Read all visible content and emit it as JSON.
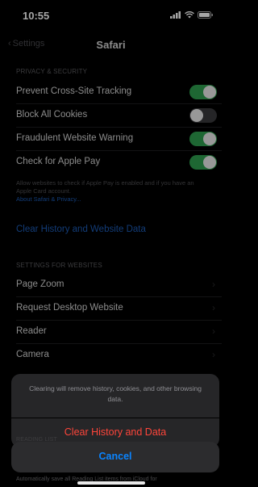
{
  "status_bar": {
    "time": "10:55"
  },
  "nav": {
    "back_label": "Settings",
    "title": "Safari"
  },
  "privacy_section": {
    "header": "PRIVACY & SECURITY",
    "rows": [
      {
        "label": "Prevent Cross-Site Tracking",
        "enabled": true
      },
      {
        "label": "Block All Cookies",
        "enabled": false
      },
      {
        "label": "Fraudulent Website Warning",
        "enabled": true
      },
      {
        "label": "Check for Apple Pay",
        "enabled": true
      }
    ],
    "footnote": "Allow websites to check if Apple Pay is enabled and if you have an Apple Card account.",
    "footnote_link": "About Safari & Privacy..."
  },
  "clear_history_link": "Clear History and Website Data",
  "websites_section": {
    "header": "SETTINGS FOR WEBSITES",
    "rows": [
      "Page Zoom",
      "Request Desktop Website",
      "Reader",
      "Camera"
    ]
  },
  "reading_list": {
    "header": "READING LIST",
    "footnote": "Automatically save all Reading List items from iCloud for"
  },
  "action_sheet": {
    "message": "Clearing will remove history, cookies, and other browsing data.",
    "destructive_label": "Clear History and Data",
    "cancel_label": "Cancel"
  },
  "colors": {
    "toggle_on": "#2f9e4f",
    "destructive": "#ff453a",
    "link": "#1d5db8",
    "cancel": "#0a84ff"
  }
}
